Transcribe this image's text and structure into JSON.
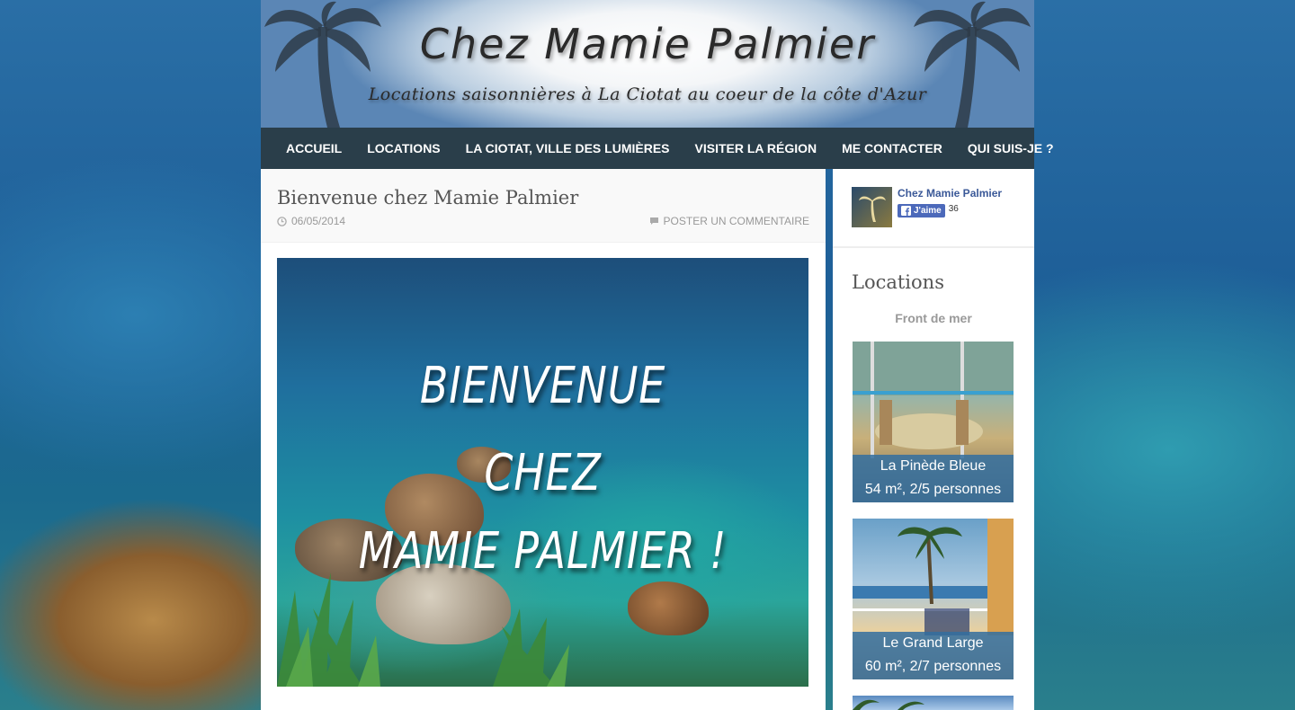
{
  "header": {
    "title": "Chez Mamie Palmier",
    "tagline": "Locations saisonnières à La Ciotat au coeur de la côte d'Azur"
  },
  "nav": {
    "items": [
      {
        "label": "ACCUEIL"
      },
      {
        "label": "LOCATIONS"
      },
      {
        "label": "LA CIOTAT, VILLE DES LUMIÈRES"
      },
      {
        "label": "VISITER LA RÉGION"
      },
      {
        "label": "ME CONTACTER"
      },
      {
        "label": "QUI SUIS-JE ?"
      }
    ]
  },
  "post": {
    "title": "Bienvenue chez Mamie Palmier",
    "date": "06/05/2014",
    "comment_link": "POSTER UN COMMENTAIRE",
    "hero_lines": [
      "BIENVENUE",
      "CHEZ",
      "MAMIE PALMIER !"
    ]
  },
  "sidebar": {
    "facebook": {
      "page_name": "Chez Mamie Palmier",
      "like_label": "J'aime",
      "like_count": "36"
    },
    "widget_title": "Locations",
    "section_label": "Front de mer",
    "listings": [
      {
        "name": "La Pinède Bleue",
        "details": "54 m², 2/5 personnes"
      },
      {
        "name": "Le Grand Large",
        "details": "60 m², 2/7 personnes"
      }
    ]
  },
  "colors": {
    "nav_bg": "#2a3e4a",
    "caption_bg": "#326ea0",
    "facebook_blue": "#4c69ba"
  }
}
